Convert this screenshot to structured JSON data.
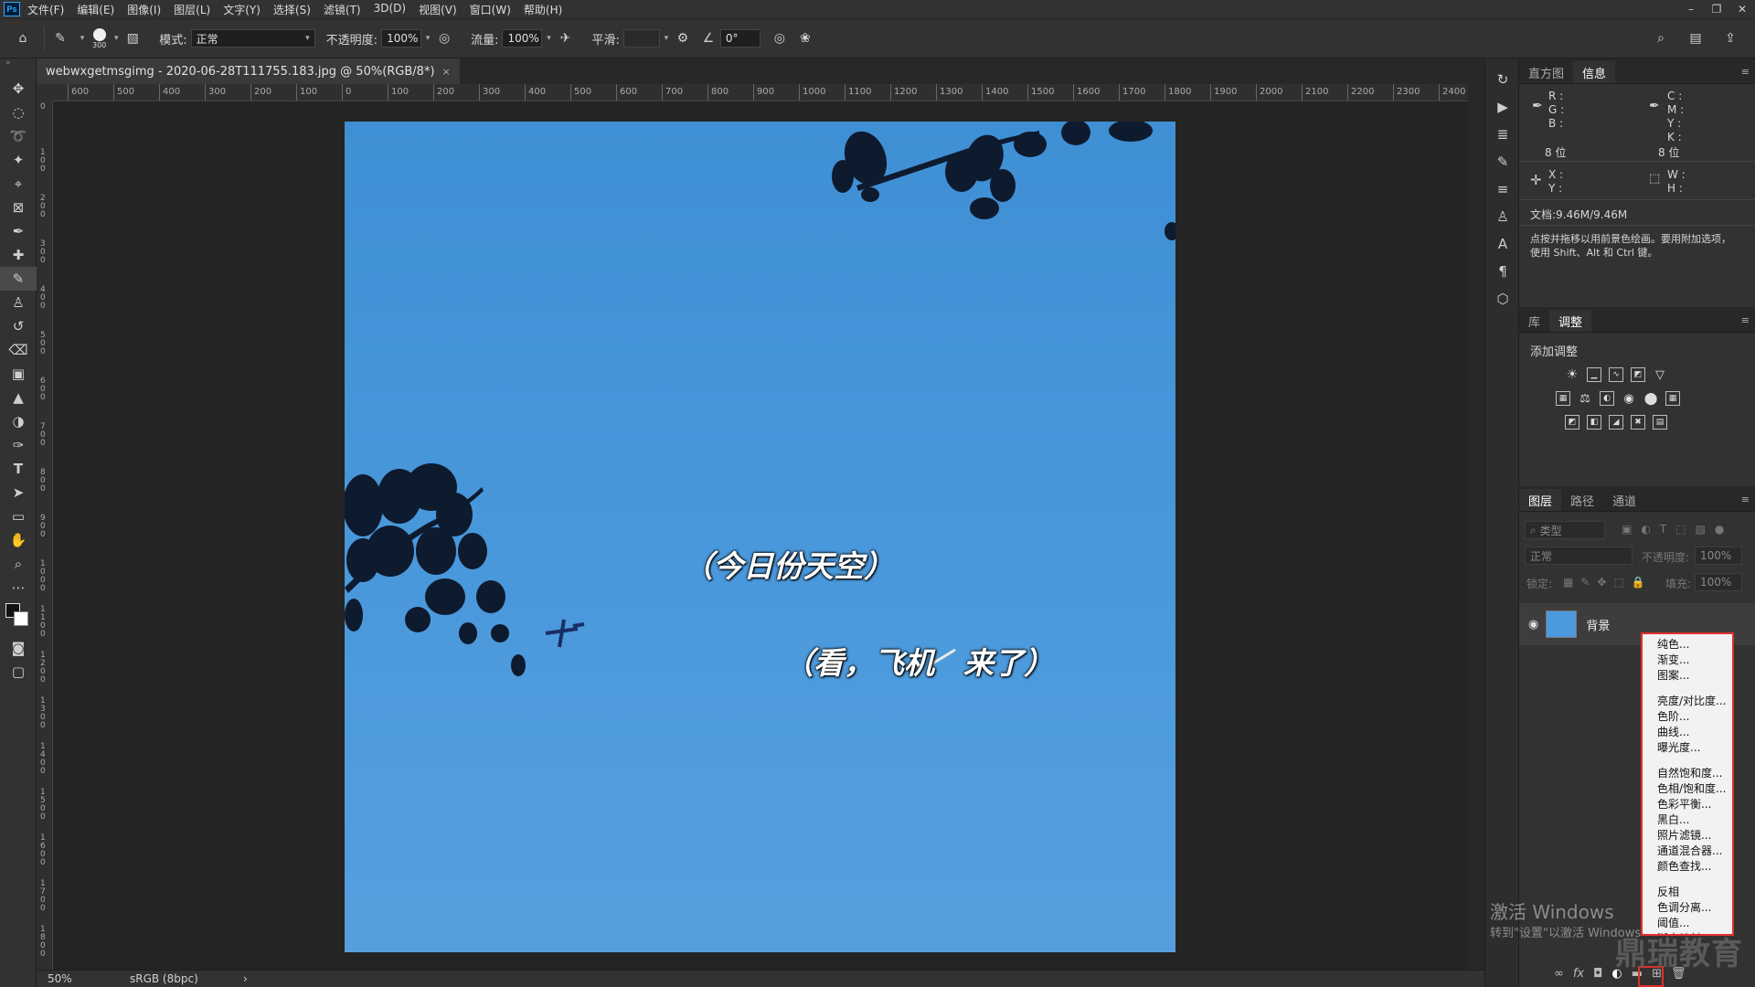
{
  "menubar": {
    "logo": "Ps",
    "items": [
      "文件(F)",
      "编辑(E)",
      "图像(I)",
      "图层(L)",
      "文字(Y)",
      "选择(S)",
      "滤镜(T)",
      "3D(D)",
      "视图(V)",
      "窗口(W)",
      "帮助(H)"
    ]
  },
  "options_bar": {
    "brush_size": "300",
    "mode_label": "模式:",
    "mode_value": "正常",
    "opacity_label": "不透明度:",
    "opacity_value": "100%",
    "flow_label": "流量:",
    "flow_value": "100%",
    "smooth_label": "平滑:",
    "smooth_value": "",
    "angle_value": "0°"
  },
  "document": {
    "tab_title": "webwxgetmsgimg - 2020-06-28T111755.183.jpg @ 50%(RGB/8*)",
    "close_glyph": "×",
    "ruler_h_labels": [
      "600",
      "500",
      "400",
      "300",
      "200",
      "100",
      "0",
      "100",
      "200",
      "300",
      "400",
      "500",
      "600",
      "700",
      "800",
      "900",
      "1000",
      "1100",
      "1200",
      "1300",
      "1400",
      "1500",
      "1600",
      "1700",
      "1800",
      "1900",
      "2000",
      "2100",
      "2200",
      "2300",
      "2400"
    ],
    "ruler_v_labels": [
      "0",
      "1\n0\n0",
      "2\n0\n0",
      "3\n0\n0",
      "4\n0\n0",
      "5\n0\n0",
      "6\n0\n0",
      "7\n0\n0",
      "8\n0\n0",
      "9\n0\n0",
      "1\n0\n0\n0",
      "1\n1\n0\n0",
      "1\n2\n0\n0",
      "1\n3\n0\n0",
      "1\n4\n0\n0",
      "1\n5\n0\n0",
      "1\n6\n0\n0",
      "1\n7\n0\n0",
      "1\n8\n0\n0"
    ],
    "caption1": "（今日份天空）",
    "caption2": "（看，飞机",
    "caption3": "来了）"
  },
  "status": {
    "zoom": "50%",
    "profile": "sRGB (8bpc)",
    "arrow": "›"
  },
  "info_panel": {
    "tabs": [
      "直方图",
      "信息"
    ],
    "rgb": "R :\nG :\nB :",
    "cmyk": "C :\nM :\nY :\nK :",
    "bits_left": "8 位",
    "bits_right": "8 位",
    "xy": "X :\nY :",
    "wh": "W :\nH :",
    "doc_size": "文档:9.46M/9.46M",
    "hint": "点按并拖移以用前景色绘画。要用附加选项，使用 Shift、Alt 和 Ctrl 键。"
  },
  "adjust_panel": {
    "tabs": [
      "库",
      "调整"
    ],
    "heading": "添加调整"
  },
  "layers_panel": {
    "tabs": [
      "图层",
      "路径",
      "通道"
    ],
    "kind_placeholder": "类型",
    "blend_mode": "正常",
    "opacity_label": "不透明度:",
    "opacity_value": "100%",
    "lock_label": "锁定:",
    "fill_label": "填充:",
    "fill_value": "100%",
    "layer_name": "背景"
  },
  "adjust_menu": {
    "groups": [
      [
        "纯色...",
        "渐变...",
        "图案..."
      ],
      [
        "亮度/对比度...",
        "色阶...",
        "曲线...",
        "曝光度..."
      ],
      [
        "自然饱和度...",
        "色相/饱和度...",
        "色彩平衡...",
        "黑白...",
        "照片滤镜...",
        "通道混合器...",
        "颜色查找..."
      ],
      [
        "反相",
        "色调分离...",
        "阈值...",
        "渐变映射..."
      ]
    ]
  },
  "watermarks": {
    "activate_title": "激活 Windows",
    "activate_sub": "转到\"设置\"以激活 Windows",
    "brand": "鼎瑞教育"
  }
}
